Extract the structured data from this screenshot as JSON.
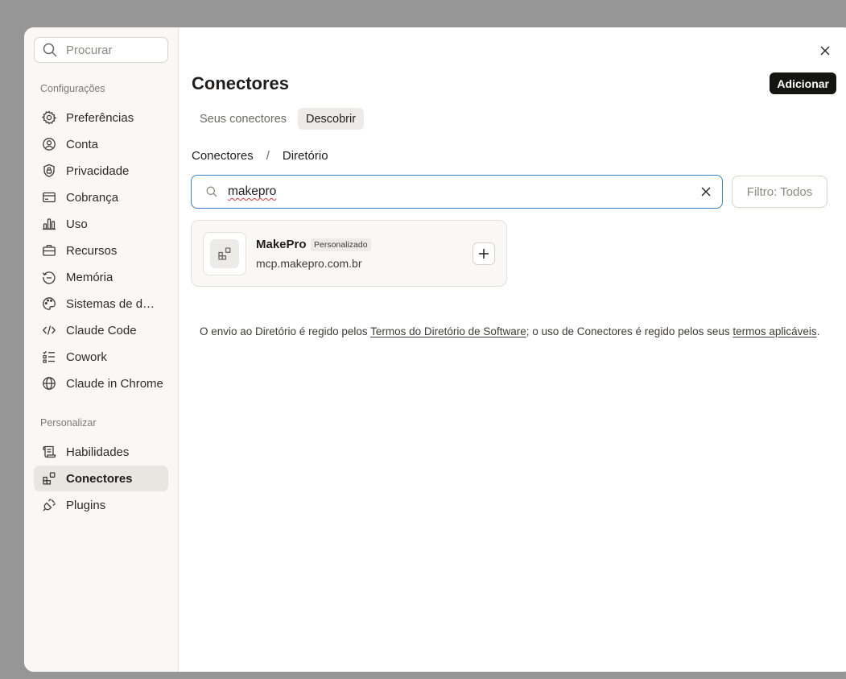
{
  "sidebar": {
    "search_placeholder": "Procurar",
    "section_settings": "Configurações",
    "section_customize": "Personalizar",
    "items": [
      {
        "label": "Preferências",
        "icon": "gear-icon"
      },
      {
        "label": "Conta",
        "icon": "user-circle-icon"
      },
      {
        "label": "Privacidade",
        "icon": "shield-lock-icon"
      },
      {
        "label": "Cobrança",
        "icon": "credit-card-icon"
      },
      {
        "label": "Uso",
        "icon": "bar-chart-icon"
      },
      {
        "label": "Recursos",
        "icon": "briefcase-icon"
      },
      {
        "label": "Memória",
        "icon": "memory-icon"
      },
      {
        "label": "Sistemas de design",
        "icon": "palette-icon"
      },
      {
        "label": "Claude Code",
        "icon": "code-icon"
      },
      {
        "label": "Cowork",
        "icon": "checklist-icon"
      },
      {
        "label": "Claude in Chrome",
        "icon": "globe-icon"
      }
    ],
    "custom_items": [
      {
        "label": "Habilidades",
        "icon": "scroll-icon"
      },
      {
        "label": "Conectores",
        "icon": "connectors-icon",
        "active": true
      },
      {
        "label": "Plugins",
        "icon": "plug-icon"
      }
    ]
  },
  "main": {
    "title": "Conectores",
    "add_label": "Adicionar",
    "tabs": [
      {
        "label": "Seus conectores",
        "active": false
      },
      {
        "label": "Descobrir",
        "active": true
      }
    ],
    "breadcrumb": {
      "root": "Conectores",
      "separator": "/",
      "current": "Diretório"
    },
    "search_value": "makepro",
    "filter_label": "Filtro: Todos",
    "results": [
      {
        "name": "MakePro",
        "badge": "Personalizado",
        "url": "mcp.makepro.com.br"
      }
    ],
    "footnote": {
      "text1": "O envio ao Diretório é regido pelos ",
      "link1": "Termos do Diretório de Software",
      "text2": "; o uso de Conectores é regido pelos seus ",
      "link2": "termos aplicáveis",
      "text3": "."
    }
  },
  "colors": {
    "backdrop": "#969696",
    "accent_focus": "#3b82c4",
    "primary_button": "#141413",
    "sidebar_bg": "#f9f8f6",
    "active_item_bg": "#e8e6e1"
  }
}
